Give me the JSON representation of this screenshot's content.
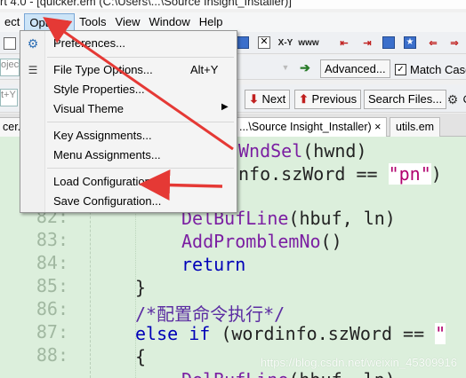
{
  "window": {
    "title": "rt 4.0 - [quicker.em (C:\\Users\\...\\Source Insight_Installer)]"
  },
  "menubar": [
    {
      "label": "ect"
    },
    {
      "label": "Options",
      "active": true
    },
    {
      "label": "Tools"
    },
    {
      "label": "View"
    },
    {
      "label": "Window"
    },
    {
      "label": "Help"
    }
  ],
  "toolbar": {
    "search_value": "ojec",
    "advanced_label": "Advanced...",
    "match_case_label": "Match Case",
    "match_case_checked": true,
    "next_label": "Next",
    "previous_label": "Previous",
    "search_files_label": "Search Files...",
    "left_field_value": "t+Y"
  },
  "tabs": [
    {
      "label": "cer.em ×",
      "active": false
    },
    {
      "label": "...\\Source Insight_Installer) ×",
      "active": true
    },
    {
      "label": "utils.em",
      "active": false
    }
  ],
  "options_menu": {
    "items": [
      {
        "label": "Preferences...",
        "shortcut": "",
        "icon": "gear-icon",
        "submenu": false
      },
      {
        "label": "File Type Options...",
        "shortcut": "Alt+Y",
        "icon": "list-icon",
        "submenu": false
      },
      {
        "label": "Style Properties...",
        "shortcut": "",
        "icon": "",
        "submenu": false
      },
      {
        "label": "Visual Theme",
        "shortcut": "",
        "icon": "",
        "submenu": true
      },
      {
        "label": "Key Assignments...",
        "shortcut": "",
        "icon": "",
        "submenu": false
      },
      {
        "label": "Menu Assignments...",
        "shortcut": "",
        "icon": "",
        "submenu": false
      },
      {
        "label": "Load Configuration...",
        "shortcut": "",
        "icon": "",
        "submenu": false
      },
      {
        "label": "Save Configuration...",
        "shortcut": "",
        "icon": "",
        "submenu": false
      }
    ]
  },
  "editor": {
    "line_numbers": [
      "82:",
      "83:",
      "84:",
      "85:",
      "86:",
      "87:",
      "88:"
    ],
    "code": {
      "l1_fn": "WndSel",
      "l1_rest": "(hwnd)",
      "l2_a": "nfo.szWord == ",
      "l2_str": "\"pn\"",
      "l2_b": ")",
      "l3_fn": "DelBufLine",
      "l3_rest": "(hbuf, ln)",
      "l4_fn": "AddPromblemNo",
      "l4_rest": "()",
      "l5_kw": "return",
      "l6": "}",
      "l7_cmt": "/*配置命令执行*/",
      "l8_kw": "else if",
      "l8_rest": " (wordinfo.szWord == ",
      "l8_str": "\"",
      "l9": "{",
      "l10_fn": "DelBufLine",
      "l10_rest": "(hbuf, ln)"
    }
  },
  "watermark": "https://blog.csdn.net/weixin_45309916",
  "colors": {
    "editor_bg": "#dcefdc",
    "keyword": "#0000b8",
    "function": "#7b1fa2",
    "string": "#b1006e",
    "annotation_red": "#e53935"
  }
}
